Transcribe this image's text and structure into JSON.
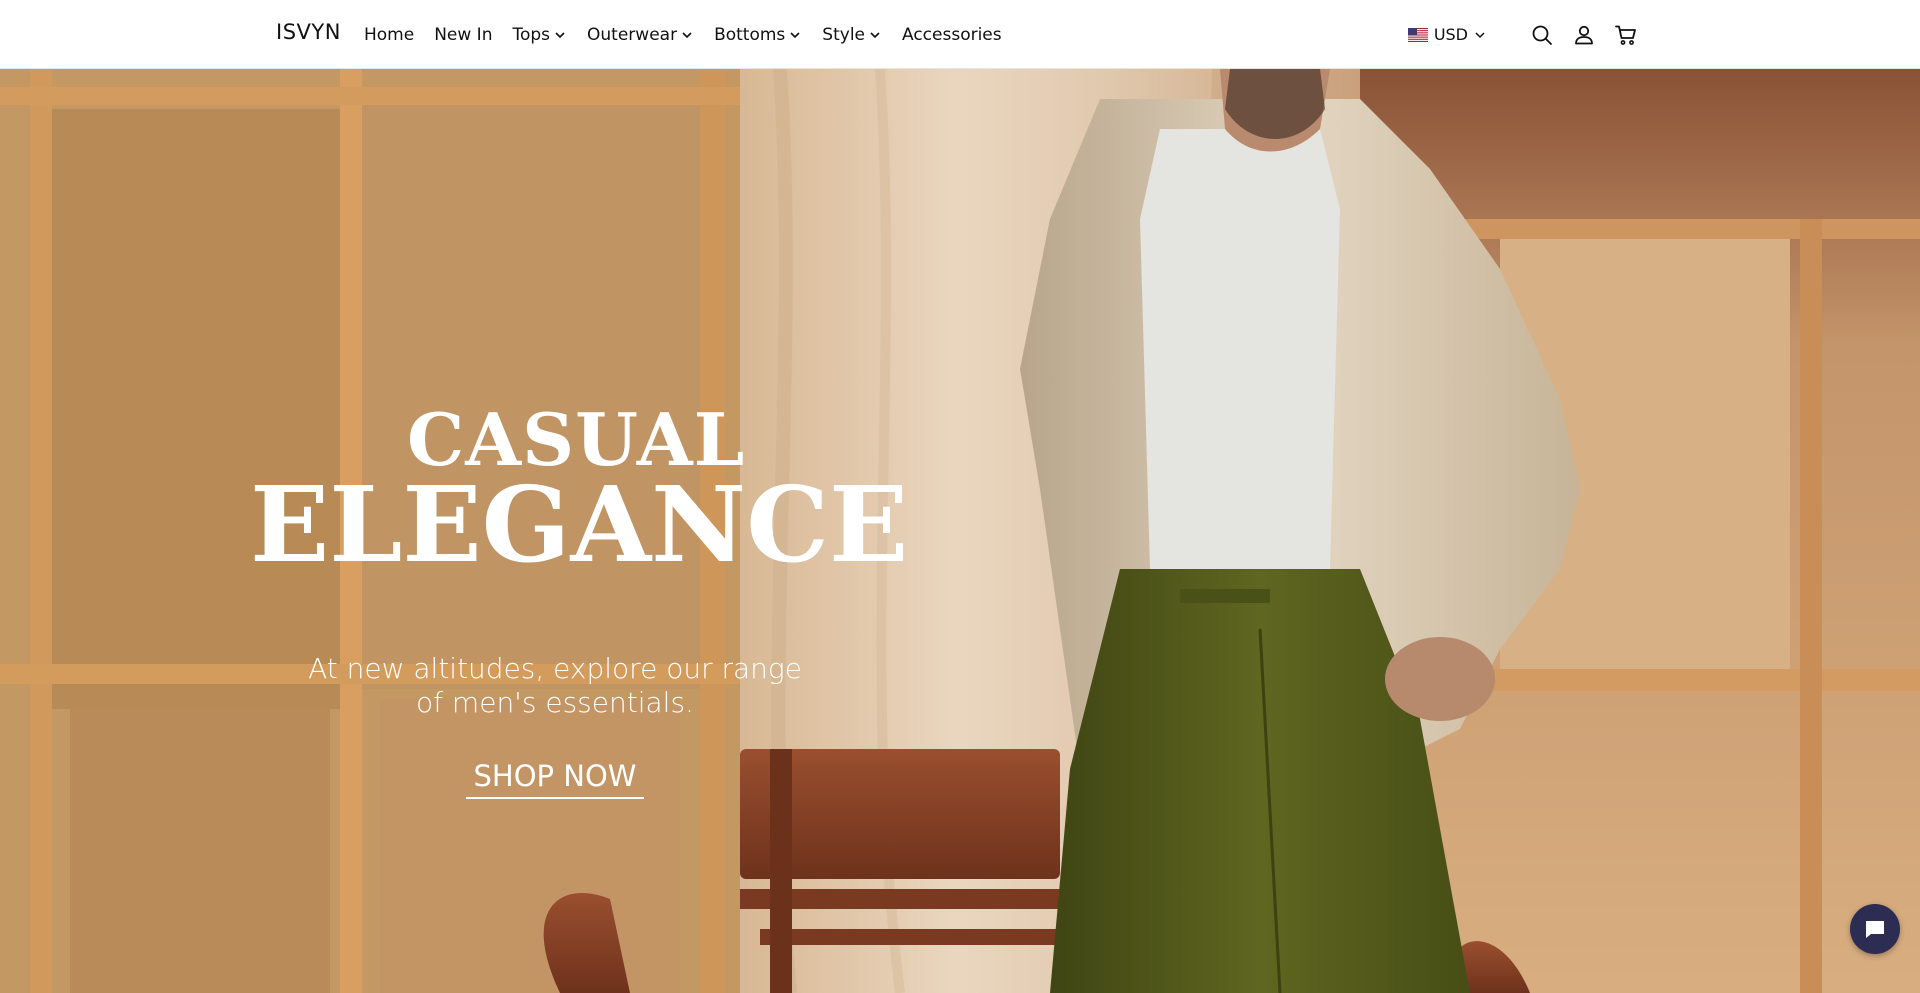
{
  "brand": {
    "logo_text": "ISVYN"
  },
  "nav": {
    "items": [
      {
        "label": "Home",
        "has_dropdown": false
      },
      {
        "label": "New In",
        "has_dropdown": false
      },
      {
        "label": "Tops",
        "has_dropdown": true
      },
      {
        "label": "Outerwear",
        "has_dropdown": true
      },
      {
        "label": "Bottoms",
        "has_dropdown": true
      },
      {
        "label": "Style",
        "has_dropdown": true
      },
      {
        "label": "Accessories",
        "has_dropdown": false
      }
    ]
  },
  "utilities": {
    "currency": {
      "label": "USD",
      "flag_icon": "us-flag-icon"
    },
    "icons": [
      "search-icon",
      "account-icon",
      "cart-icon"
    ]
  },
  "hero": {
    "title_line1": "CASUAL",
    "title_line2": "ELEGANCE",
    "subtitle_line1": "At new altitudes, explore our range",
    "subtitle_line2": "of men's essentials.",
    "cta_label": "SHOP NOW"
  },
  "chat": {
    "icon": "chat-bubble-icon",
    "color": "#2d2c52"
  }
}
